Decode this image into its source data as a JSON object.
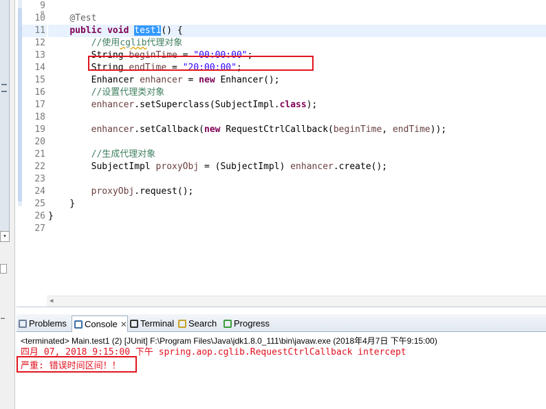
{
  "editor": {
    "lines": [
      {
        "n": "9",
        "tokens": []
      },
      {
        "n": "10",
        "tokens": [
          {
            "t": "    "
          },
          {
            "t": "@Test",
            "c": "ann"
          }
        ]
      },
      {
        "n": "11",
        "tokens": [
          {
            "t": "    "
          },
          {
            "t": "public",
            "c": "kw"
          },
          {
            "t": " "
          },
          {
            "t": "void",
            "c": "kw"
          },
          {
            "t": " "
          },
          {
            "t": "test1",
            "c": "sel"
          },
          {
            "t": "() {"
          }
        ]
      },
      {
        "n": "12",
        "tokens": [
          {
            "t": "        "
          },
          {
            "t": "//使用",
            "c": "cmt"
          },
          {
            "t": "cglib",
            "c": "cmt squig"
          },
          {
            "t": "代理对象",
            "c": "cmt"
          }
        ]
      },
      {
        "n": "13",
        "tokens": [
          {
            "t": "        String "
          },
          {
            "t": "beginTime",
            "c": "var"
          },
          {
            "t": " = "
          },
          {
            "t": "\"00:00:00\"",
            "c": "str"
          },
          {
            "t": ";"
          }
        ]
      },
      {
        "n": "14",
        "tokens": [
          {
            "t": "        String "
          },
          {
            "t": "endTime",
            "c": "var"
          },
          {
            "t": " = "
          },
          {
            "t": "\"20:00:00\"",
            "c": "str"
          },
          {
            "t": ";"
          }
        ]
      },
      {
        "n": "15",
        "tokens": [
          {
            "t": "        Enhancer "
          },
          {
            "t": "enhancer",
            "c": "var"
          },
          {
            "t": " = "
          },
          {
            "t": "new",
            "c": "kw"
          },
          {
            "t": " Enhancer();"
          }
        ]
      },
      {
        "n": "16",
        "tokens": [
          {
            "t": "        "
          },
          {
            "t": "//设置代理类对象",
            "c": "cmt"
          }
        ]
      },
      {
        "n": "17",
        "tokens": [
          {
            "t": "        "
          },
          {
            "t": "enhancer",
            "c": "var"
          },
          {
            "t": ".setSuperclass(SubjectImpl."
          },
          {
            "t": "class",
            "c": "kw"
          },
          {
            "t": ");"
          }
        ]
      },
      {
        "n": "18",
        "tokens": []
      },
      {
        "n": "19",
        "tokens": [
          {
            "t": "        "
          },
          {
            "t": "enhancer",
            "c": "var"
          },
          {
            "t": ".setCallback("
          },
          {
            "t": "new",
            "c": "kw"
          },
          {
            "t": " RequestCtrlCallback("
          },
          {
            "t": "beginTime",
            "c": "var"
          },
          {
            "t": ", "
          },
          {
            "t": "endTime",
            "c": "var"
          },
          {
            "t": "));"
          }
        ]
      },
      {
        "n": "20",
        "tokens": []
      },
      {
        "n": "21",
        "tokens": [
          {
            "t": "        "
          },
          {
            "t": "//生成代理对象",
            "c": "cmt"
          }
        ]
      },
      {
        "n": "22",
        "tokens": [
          {
            "t": "        SubjectImpl "
          },
          {
            "t": "proxyObj",
            "c": "var"
          },
          {
            "t": " = (SubjectImpl) "
          },
          {
            "t": "enhancer",
            "c": "var"
          },
          {
            "t": ".create();"
          }
        ]
      },
      {
        "n": "23",
        "tokens": []
      },
      {
        "n": "24",
        "tokens": [
          {
            "t": "        "
          },
          {
            "t": "proxyObj",
            "c": "var"
          },
          {
            "t": ".request();"
          }
        ]
      },
      {
        "n": "25",
        "tokens": [
          {
            "t": "    }"
          }
        ]
      },
      {
        "n": "26",
        "tokens": [
          {
            "t": "}"
          }
        ]
      },
      {
        "n": "27",
        "tokens": []
      }
    ]
  },
  "console": {
    "tabs": [
      {
        "name": "tab-problems",
        "label": "Problems",
        "icon": "problems-icon",
        "active": false
      },
      {
        "name": "tab-console",
        "label": "Console",
        "icon": "console-icon",
        "active": true
      },
      {
        "name": "tab-terminal",
        "label": "Terminal",
        "icon": "terminal-icon",
        "active": false
      },
      {
        "name": "tab-search",
        "label": "Search",
        "icon": "search-icon",
        "active": false
      },
      {
        "name": "tab-progress",
        "label": "Progress",
        "icon": "progress-icon",
        "active": false
      }
    ],
    "close_glyph": "✕",
    "header": "<terminated> Main.test1 (2) [JUnit] F:\\Program Files\\Java\\jdk1.8.0_111\\bin\\javaw.exe (2018年4月7日 下午9:15:00)",
    "output_lines": [
      "四月 07, 2018 9:15:00 下午 spring.aop.cglib.RequestCtrlCallback intercept",
      "严重: 错误时间区间！！"
    ]
  }
}
